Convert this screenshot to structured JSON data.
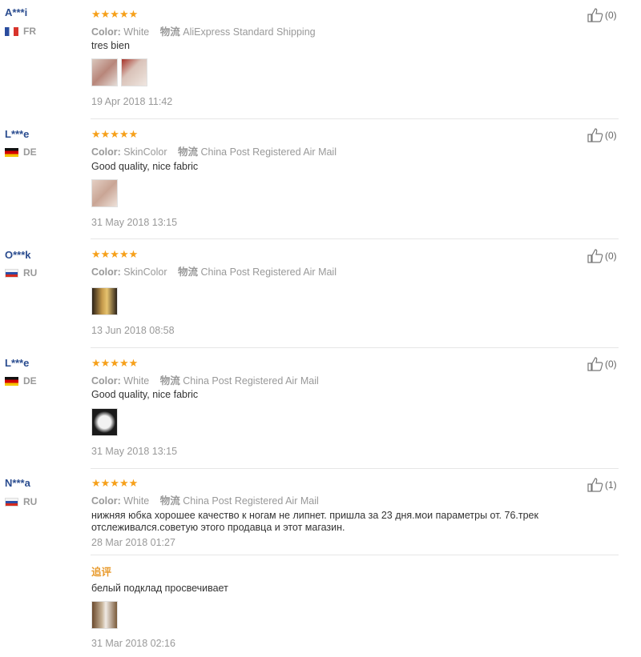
{
  "reviews": [
    {
      "user": "A***i",
      "country": "FR",
      "stars": "★★★★★",
      "color_label": "Color:",
      "color_value": "White",
      "ship_label": "物流",
      "ship_value": "AliExpress Standard Shipping",
      "text": "tres bien",
      "date": "19 Apr 2018 11:42",
      "likes": "(0)"
    },
    {
      "user": "L***e",
      "country": "DE",
      "stars": "★★★★★",
      "color_label": "Color:",
      "color_value": "SkinColor",
      "ship_label": "物流",
      "ship_value": "China Post Registered Air Mail",
      "text": "Good quality, nice fabric",
      "date": "31 May 2018 13:15",
      "likes": "(0)"
    },
    {
      "user": "O***k",
      "country": "RU",
      "stars": "★★★★★",
      "color_label": "Color:",
      "color_value": "SkinColor",
      "ship_label": "物流",
      "ship_value": "China Post Registered Air Mail",
      "text": "",
      "date": "13 Jun 2018 08:58",
      "likes": "(0)"
    },
    {
      "user": "L***e",
      "country": "DE",
      "stars": "★★★★★",
      "color_label": "Color:",
      "color_value": "White",
      "ship_label": "物流",
      "ship_value": "China Post Registered Air Mail",
      "text": "Good quality, nice fabric",
      "date": "31 May 2018 13:15",
      "likes": "(0)"
    },
    {
      "user": "N***a",
      "country": "RU",
      "stars": "★★★★★",
      "color_label": "Color:",
      "color_value": "White",
      "ship_label": "物流",
      "ship_value": "China Post Registered Air Mail",
      "text_line1": "нижняя юбка хорошее качество к ногам не липнет. пришла за 23 дня.мои параметры от. 76.трек",
      "text_line2": "отслеживался.советую этого продавца и этот магазин.",
      "date": "28 Mar 2018 01:27",
      "likes": "(1)",
      "followup_label": "追评",
      "followup_text": "белый подклад просвечивает",
      "followup_date": "31 Mar 2018 02:16"
    }
  ],
  "colors": {
    "stars": "#f6a01a",
    "username": "#2a4c8f",
    "followup": "#e89a2c"
  }
}
